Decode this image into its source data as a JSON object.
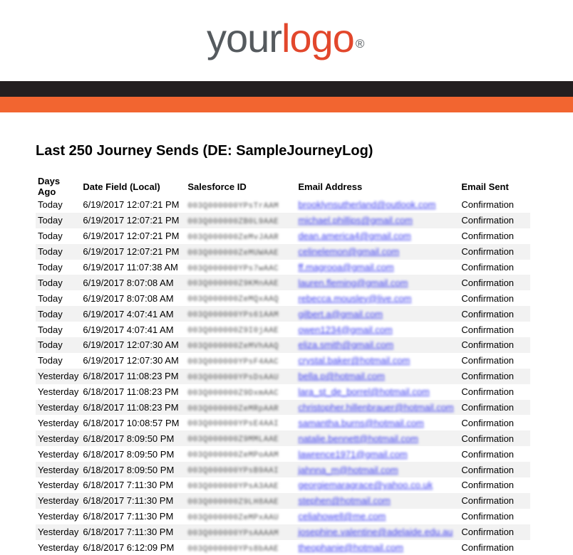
{
  "logo": {
    "your": "your",
    "logo": "logo",
    "reg": "®"
  },
  "title": "Last 250 Journey Sends (DE: SampleJourneyLog)",
  "columns": [
    "Days Ago",
    "Date Field (Local)",
    "Salesforce ID",
    "Email Address",
    "Email Sent"
  ],
  "rows": [
    {
      "days": "Today",
      "date": "6/19/2017 12:07:21 PM",
      "sfid": "003Q000000YPsTrAAM",
      "email": "brooklynsutherland@outlook.com",
      "sent": "Confirmation"
    },
    {
      "days": "Today",
      "date": "6/19/2017 12:07:21 PM",
      "sfid": "003Q000000ZB0L9AAE",
      "email": "michael.phillips@gmail.com",
      "sent": "Confirmation"
    },
    {
      "days": "Today",
      "date": "6/19/2017 12:07:21 PM",
      "sfid": "003Q000000ZeMvJAAR",
      "email": "dean.america4@gmail.com",
      "sent": "Confirmation"
    },
    {
      "days": "Today",
      "date": "6/19/2017 12:07:21 PM",
      "sfid": "003Q000000ZeMUWAAE",
      "email": "celinelemon@gmail.com",
      "sent": "Confirmation"
    },
    {
      "days": "Today",
      "date": "6/19/2017 11:07:38 AM",
      "sfid": "003Q000000YPs7wAAC",
      "email": "ff.magrooa@gmail.com",
      "sent": "Confirmation"
    },
    {
      "days": "Today",
      "date": "6/19/2017 8:07:08 AM",
      "sfid": "003Q000000Z9KMnAAE",
      "email": "lauren.fleming@gmail.com",
      "sent": "Confirmation"
    },
    {
      "days": "Today",
      "date": "6/19/2017 8:07:08 AM",
      "sfid": "003Q000000ZeMQxAAQ",
      "email": "rebecca.mousley@live.com",
      "sent": "Confirmation"
    },
    {
      "days": "Today",
      "date": "6/19/2017 4:07:41 AM",
      "sfid": "003Q000000YPs61AAM",
      "email": "gilbert.a@gmail.com",
      "sent": "Confirmation"
    },
    {
      "days": "Today",
      "date": "6/19/2017 4:07:41 AM",
      "sfid": "003Q000000Z9I0jAAE",
      "email": "owen1234@gmail.com",
      "sent": "Confirmation"
    },
    {
      "days": "Today",
      "date": "6/19/2017 12:07:30 AM",
      "sfid": "003Q000000ZeMVhAAQ",
      "email": "eliza.smith@gmail.com",
      "sent": "Confirmation"
    },
    {
      "days": "Today",
      "date": "6/19/2017 12:07:30 AM",
      "sfid": "003Q000000YPsF4AAC",
      "email": "crystal.baker@hotmail.com",
      "sent": "Confirmation"
    },
    {
      "days": "Yesterday",
      "date": "6/18/2017 11:08:23 PM",
      "sfid": "003Q000000YPsDsAAU",
      "email": "bella.p@hotmail.com",
      "sent": "Confirmation"
    },
    {
      "days": "Yesterday",
      "date": "6/18/2017 11:08:23 PM",
      "sfid": "003Q000000Z9DxmAAC",
      "email": "lara_st_de_borrel@hotmail.com",
      "sent": "Confirmation"
    },
    {
      "days": "Yesterday",
      "date": "6/18/2017 11:08:23 PM",
      "sfid": "003Q000000ZeMRpAAR",
      "email": "christopher.hillenbrauer@hotmail.com",
      "sent": "Confirmation"
    },
    {
      "days": "Yesterday",
      "date": "6/18/2017 10:08:57 PM",
      "sfid": "003Q000000YPsE4AAI",
      "email": "samantha.burns@hotmail.com",
      "sent": "Confirmation"
    },
    {
      "days": "Yesterday",
      "date": "6/18/2017 8:09:50 PM",
      "sfid": "003Q000000Z9MMLAAE",
      "email": "natalie.bennett@hotmail.com",
      "sent": "Confirmation"
    },
    {
      "days": "Yesterday",
      "date": "6/18/2017 8:09:50 PM",
      "sfid": "003Q000000ZeMPoAAM",
      "email": "lawrence1971@gmail.com",
      "sent": "Confirmation"
    },
    {
      "days": "Yesterday",
      "date": "6/18/2017 8:09:50 PM",
      "sfid": "003Q000000YPsB9AAI",
      "email": "jahnna_m@hotmail.com",
      "sent": "Confirmation"
    },
    {
      "days": "Yesterday",
      "date": "6/18/2017 7:11:30 PM",
      "sfid": "003Q000000YPsA3AAE",
      "email": "georgiemaragrace@yahoo.co.uk",
      "sent": "Confirmation"
    },
    {
      "days": "Yesterday",
      "date": "6/18/2017 7:11:30 PM",
      "sfid": "003Q000000Z9LH8AAE",
      "email": "stephen@hotmail.com",
      "sent": "Confirmation"
    },
    {
      "days": "Yesterday",
      "date": "6/18/2017 7:11:30 PM",
      "sfid": "003Q000000ZeMPxAAU",
      "email": "celiahowell@me.com",
      "sent": "Confirmation"
    },
    {
      "days": "Yesterday",
      "date": "6/18/2017 7:11:30 PM",
      "sfid": "003Q000000YPsAAAAM",
      "email": "josephine.valentine@adelaide.edu.au",
      "sent": "Confirmation"
    },
    {
      "days": "Yesterday",
      "date": "6/18/2017 6:12:09 PM",
      "sfid": "003Q000000YPs8bAAE",
      "email": "theophanie@hotmail.com",
      "sent": "Confirmation"
    }
  ],
  "colors": {
    "dark_bar": "#231f20",
    "orange_bar": "#f26530",
    "logo_gray": "#555a5e",
    "logo_orange": "#e2472c",
    "link": "#3c3cf0"
  }
}
